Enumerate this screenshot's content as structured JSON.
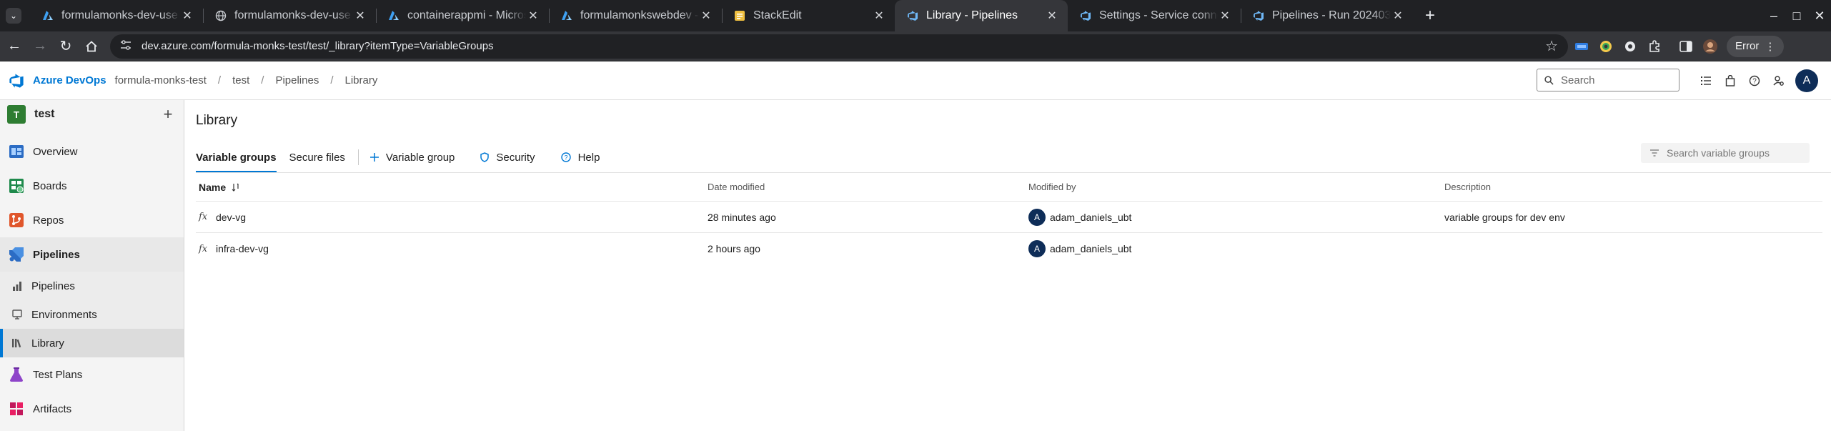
{
  "browser": {
    "tabs": [
      {
        "title": "formulamonks-dev-use",
        "icon": "azure-icon",
        "active": false
      },
      {
        "title": "formulamonks-dev-use",
        "icon": "globe-icon",
        "active": false
      },
      {
        "title": "containerappmi - Micros",
        "icon": "azure-icon",
        "active": false
      },
      {
        "title": "formulamonkswebdev -",
        "icon": "azure-icon",
        "active": false
      },
      {
        "title": "StackEdit",
        "icon": "stackedit-icon",
        "active": false
      },
      {
        "title": "Library - Pipelines",
        "icon": "azure-devops-icon",
        "active": true
      },
      {
        "title": "Settings - Service conne",
        "icon": "azure-devops-icon",
        "active": false
      },
      {
        "title": "Pipelines - Run 2024032",
        "icon": "azure-devops-icon",
        "active": false
      }
    ],
    "url": "dev.azure.com/formula-monks-test/test/_library?itemType=VariableGroups",
    "error_label": "Error"
  },
  "header": {
    "brand": "Azure DevOps",
    "breadcrumbs": [
      "formula-monks-test",
      "test",
      "Pipelines",
      "Library"
    ],
    "separator": "/",
    "search_placeholder": "Search",
    "avatar_initial": "A"
  },
  "sidebar": {
    "project_initial": "T",
    "project_name": "test",
    "add_label": "+",
    "items": {
      "overview": "Overview",
      "boards": "Boards",
      "repos": "Repos",
      "pipelines": "Pipelines",
      "sub_pipelines": "Pipelines",
      "environments": "Environments",
      "library": "Library",
      "test_plans": "Test Plans",
      "artifacts": "Artifacts"
    }
  },
  "main": {
    "title": "Library",
    "tabs": [
      "Variable groups",
      "Secure files"
    ],
    "commands": {
      "add_variable_group": "Variable group",
      "security": "Security",
      "help": "Help"
    },
    "filter_placeholder": "Search variable groups",
    "columns": {
      "name": "Name",
      "date_modified": "Date modified",
      "modified_by": "Modified by",
      "description": "Description"
    },
    "rows": [
      {
        "icon": "fx",
        "name": "dev-vg",
        "date": "28 minutes ago",
        "avatar": "A",
        "user": "adam_daniels_ubt",
        "description": "variable groups for dev env"
      },
      {
        "icon": "fx",
        "name": "infra-dev-vg",
        "date": "2 hours ago",
        "avatar": "A",
        "user": "adam_daniels_ubt",
        "description": ""
      }
    ]
  }
}
